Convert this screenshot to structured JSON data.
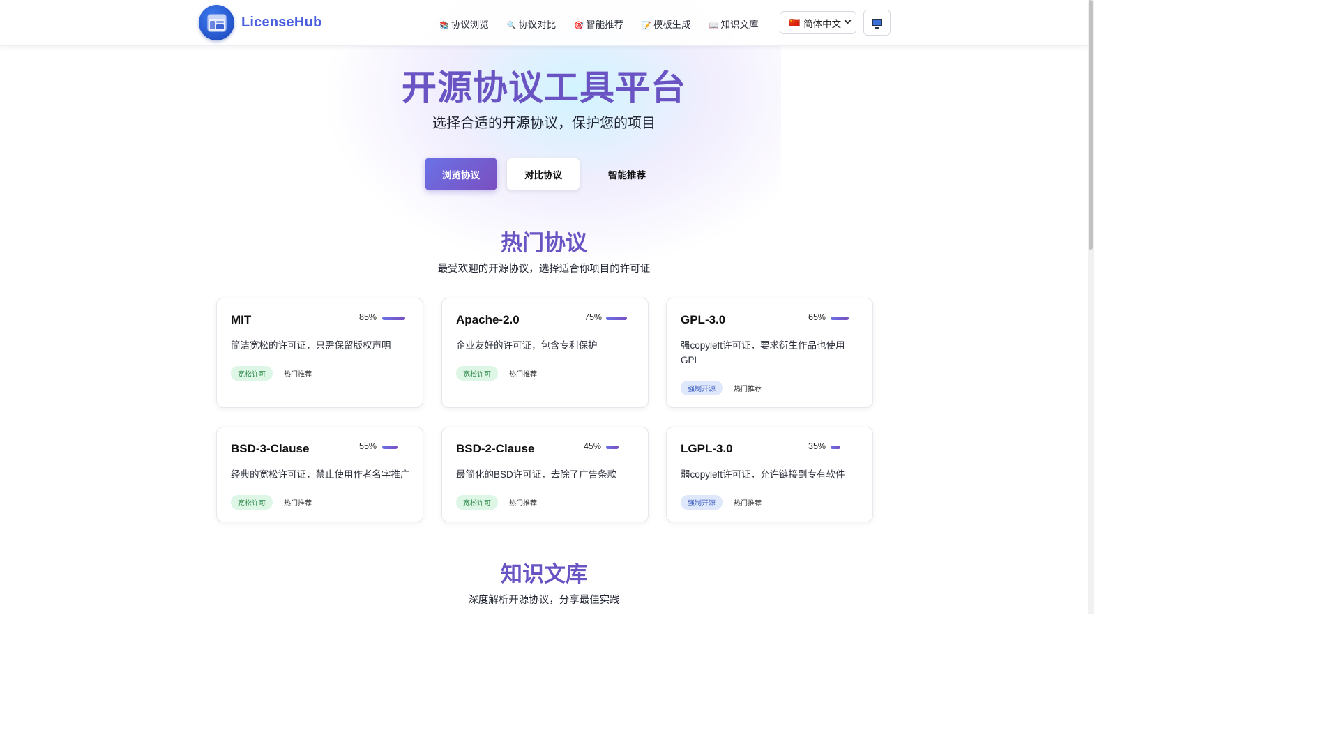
{
  "header": {
    "brand": "LicenseHub",
    "nav": [
      {
        "emoji": "📚",
        "label": "协议浏览"
      },
      {
        "emoji": "🔍",
        "label": "协议对比"
      },
      {
        "emoji": "🎯",
        "label": "智能推荐"
      },
      {
        "emoji": "📝",
        "label": "模板生成"
      },
      {
        "emoji": "📖",
        "label": "知识文库"
      }
    ],
    "language": {
      "flag": "🇨🇳",
      "label": "简体中文"
    },
    "theme_icon": "monitor-icon"
  },
  "hero": {
    "title": "开源协议工具平台",
    "subtitle": "选择合适的开源协议，保护您的项目",
    "tabs": [
      "浏览协议",
      "对比协议",
      "智能推荐"
    ]
  },
  "popular": {
    "title": "热门协议",
    "subtitle": "最受欢迎的开源协议，选择适合你项目的许可证",
    "cards": [
      {
        "name": "MIT",
        "percent": "85%",
        "popularity": 85,
        "desc": "简洁宽松的许可证，只需保留版权声明",
        "tag": "宽松许可",
        "tag_type": "green",
        "badge": "热门推荐"
      },
      {
        "name": "Apache-2.0",
        "percent": "75%",
        "popularity": 75,
        "desc": "企业友好的许可证，包含专利保护",
        "tag": "宽松许可",
        "tag_type": "green",
        "badge": "热门推荐"
      },
      {
        "name": "GPL-3.0",
        "percent": "65%",
        "popularity": 65,
        "desc": "强copyleft许可证，要求衍生作品也使用GPL",
        "tag": "强制开源",
        "tag_type": "blue",
        "badge": "热门推荐"
      },
      {
        "name": "BSD-3-Clause",
        "percent": "55%",
        "popularity": 55,
        "desc": "经典的宽松许可证，禁止使用作者名字推广",
        "tag": "宽松许可",
        "tag_type": "green",
        "badge": "热门推荐"
      },
      {
        "name": "BSD-2-Clause",
        "percent": "45%",
        "popularity": 45,
        "desc": "最简化的BSD许可证，去除了广告条款",
        "tag": "宽松许可",
        "tag_type": "green",
        "badge": "热门推荐"
      },
      {
        "name": "LGPL-3.0",
        "percent": "35%",
        "popularity": 35,
        "desc": "弱copyleft许可证，允许链接到专有软件",
        "tag": "强制开源",
        "tag_type": "blue",
        "badge": "热门推荐"
      }
    ]
  },
  "knowledge": {
    "title": "知识文库",
    "subtitle": "深度解析开源协议，分享最佳实践"
  }
}
